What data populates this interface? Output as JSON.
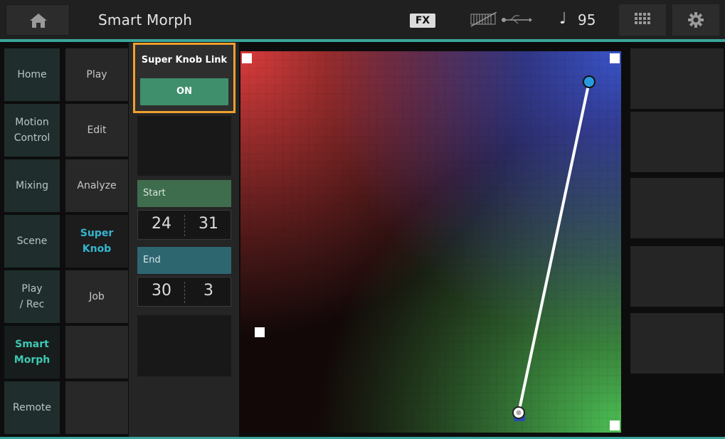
{
  "header": {
    "title": "Smart Morph",
    "fx_label": "FX",
    "tempo_symbol": "♩",
    "tempo": "95",
    "accent_color": "#3aa59a"
  },
  "icons": {
    "home": "home-icon",
    "keyboard": "keyboard-icon",
    "usb": "usb-icon",
    "grid": "grid-icon",
    "settings": "gear-icon"
  },
  "left_nav": [
    {
      "label": "Home",
      "active": false
    },
    {
      "label": "Motion\nControl",
      "active": false
    },
    {
      "label": "Mixing",
      "active": false
    },
    {
      "label": "Scene",
      "active": false
    },
    {
      "label": "Play\n/ Rec",
      "active": false
    },
    {
      "label": "Smart\nMorph",
      "active": true
    },
    {
      "label": "Remote",
      "active": false
    }
  ],
  "sub_nav": [
    {
      "label": "Play",
      "active": false
    },
    {
      "label": "Edit",
      "active": false
    },
    {
      "label": "Analyze",
      "active": false
    },
    {
      "label": "Super\nKnob",
      "active": true
    },
    {
      "label": "Job",
      "active": false
    },
    {
      "label": "",
      "active": false
    },
    {
      "label": "",
      "active": false
    }
  ],
  "super_knob_link": {
    "label": "Super Knob Link",
    "value": "ON"
  },
  "start": {
    "label": "Start",
    "x": "24",
    "y": "31"
  },
  "end": {
    "label": "End",
    "x": "30",
    "y": "3"
  },
  "colors": {
    "highlight_border": "#f0a02e",
    "on_button": "#3f8f6c",
    "start_header": "#3e6d4d",
    "end_header": "#2e6670"
  }
}
